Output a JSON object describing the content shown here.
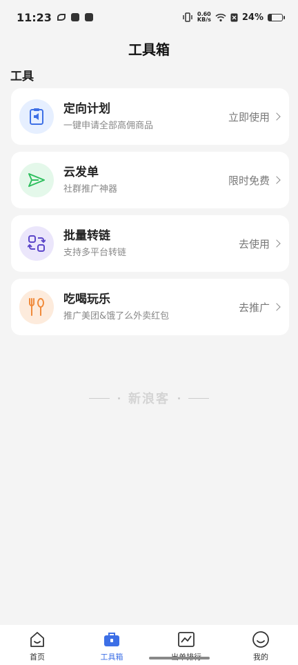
{
  "status_bar": {
    "time": "11:23",
    "net_speed_value": "0.60",
    "net_speed_unit": "KB/s",
    "battery_percent": "24%",
    "battery_level": 0.24,
    "icons": [
      "leaf-icon",
      "mail-icon",
      "tiktok-icon",
      "vibrate-icon",
      "wifi-icon",
      "no-sim-icon",
      "battery-icon"
    ]
  },
  "header": {
    "title": "工具箱"
  },
  "section": {
    "label": "工具"
  },
  "tools": [
    {
      "title": "定向计划",
      "desc": "一键申请全部高佣商品",
      "action": "立即使用",
      "icon": "clipboard-megaphone-icon",
      "icon_bg": "#e6efff",
      "icon_color": "#3d6fe6"
    },
    {
      "title": "云发单",
      "desc": "社群推广神器",
      "action": "限时免费",
      "icon": "send-icon",
      "icon_bg": "#e4f8ea",
      "icon_color": "#2fbf5e"
    },
    {
      "title": "批量转链",
      "desc": "支持多平台转链",
      "action": "去使用",
      "icon": "convert-icon",
      "icon_bg": "#ebe6fb",
      "icon_color": "#5b45c9"
    },
    {
      "title": "吃喝玩乐",
      "desc": "推广美团&饿了么外卖红包",
      "action": "去推广",
      "icon": "fork-spoon-icon",
      "icon_bg": "#fdebdc",
      "icon_color": "#f08a3a"
    }
  ],
  "watermark": {
    "text": "新浪客"
  },
  "tab_bar": {
    "tabs": [
      {
        "label": "首页",
        "icon": "home-face-icon",
        "active": false
      },
      {
        "label": "工具箱",
        "icon": "toolbox-icon",
        "active": true
      },
      {
        "label": "出单排行",
        "icon": "chart-icon",
        "active": false
      },
      {
        "label": "我的",
        "icon": "smile-icon",
        "active": false
      }
    ]
  },
  "colors": {
    "accent": "#3d6fe6",
    "background": "#f4f4f4"
  }
}
